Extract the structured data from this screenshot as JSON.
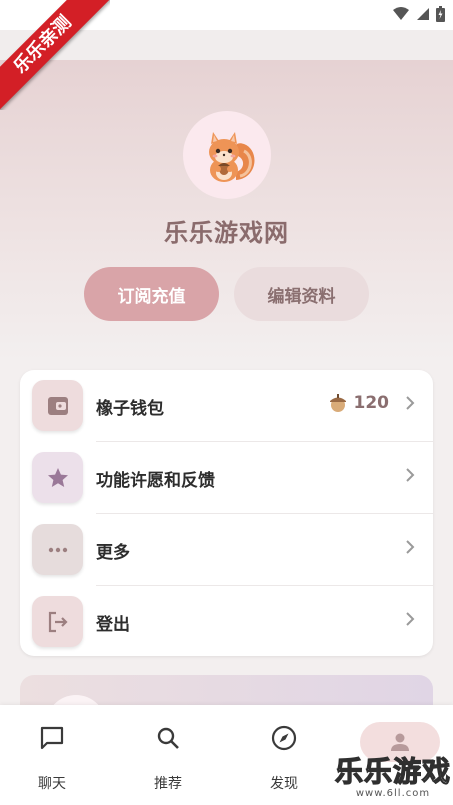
{
  "ribbon": {
    "text": "乐乐亲测"
  },
  "profile": {
    "avatar_icon": "squirrel-with-acorn",
    "username": "乐乐游戏网",
    "primary_button": "订阅充值",
    "secondary_button": "编辑资料"
  },
  "menu": {
    "items": [
      {
        "label": "橡子钱包",
        "icon": "wallet-icon",
        "trailing_icon": "acorn-icon",
        "trailing_value": "120"
      },
      {
        "label": "功能许愿和反馈",
        "icon": "star-icon"
      },
      {
        "label": "更多",
        "icon": "more-dots-icon"
      },
      {
        "label": "登出",
        "icon": "logout-icon"
      }
    ]
  },
  "promo": {
    "text": "..."
  },
  "bottom_nav": {
    "items": [
      {
        "label": "聊天",
        "icon": "chat-icon"
      },
      {
        "label": "推荐",
        "icon": "search-icon"
      },
      {
        "label": "发现",
        "icon": "compass-icon"
      },
      {
        "label": "",
        "icon": "person-icon",
        "active": true
      }
    ]
  },
  "watermark": {
    "main": "乐乐游戏",
    "sub": "www.6ll.com"
  },
  "colors": {
    "accent": "#d9a4a8",
    "username": "#8a6b6c",
    "icon_muted": "#9c7f80"
  }
}
